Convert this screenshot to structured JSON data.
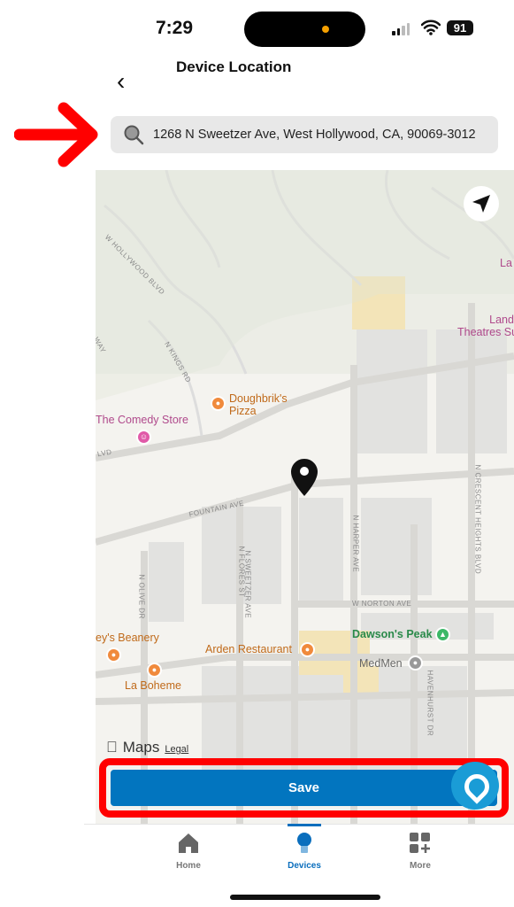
{
  "status_bar": {
    "time": "7:29",
    "battery": "91"
  },
  "header": {
    "title": "Device Location",
    "back_icon": "chevron-left-icon"
  },
  "search": {
    "value": "1268 N Sweetzer Ave, West Hollywood, CA, 90069-3012",
    "icon": "search-icon"
  },
  "annotation": {
    "arrow_color": "#ff0000",
    "highlight_color": "#ff0000"
  },
  "map": {
    "places": [
      {
        "name": "Doughbrik's Pizza",
        "line1": "Doughbrik's",
        "line2": "Pizza"
      },
      {
        "name": "The Comedy Store"
      },
      {
        "name": "Landmark Theatres Sunset",
        "line1": "Landmark",
        "line2": "Theatres Sunset"
      },
      {
        "name": "Dawson's Peak"
      },
      {
        "name": "Arden Restaurant"
      },
      {
        "name": "MedMen"
      },
      {
        "name": "La Boheme"
      },
      {
        "name": "ey's Beanery"
      },
      {
        "name": "La"
      }
    ],
    "streets": [
      "W HOLLYWOOD BLVD",
      "N KINGS RD",
      "FOUNTAIN AVE",
      "N SWEETZER AVE",
      "N HARPER AVE",
      "N CRESCENT HEIGHTS BLVD",
      "N FLORES ST",
      "N OLIVE DR",
      "W NORTON AVE",
      "HAVENHURST DR",
      "LVD",
      "WAY"
    ],
    "attribution": "Maps",
    "legal": "Legal",
    "pin_icon": "map-pin-icon",
    "locate_icon": "location-arrow-icon"
  },
  "save_button": {
    "label": "Save",
    "color": "#0275bf"
  },
  "tabbar": {
    "items": [
      {
        "label": "Home",
        "icon": "home-icon"
      },
      {
        "label": "Devices",
        "icon": "lightbulb-icon",
        "active": true
      },
      {
        "label": "More",
        "icon": "grid-plus-icon"
      }
    ],
    "active_color": "#0a6ebd"
  }
}
